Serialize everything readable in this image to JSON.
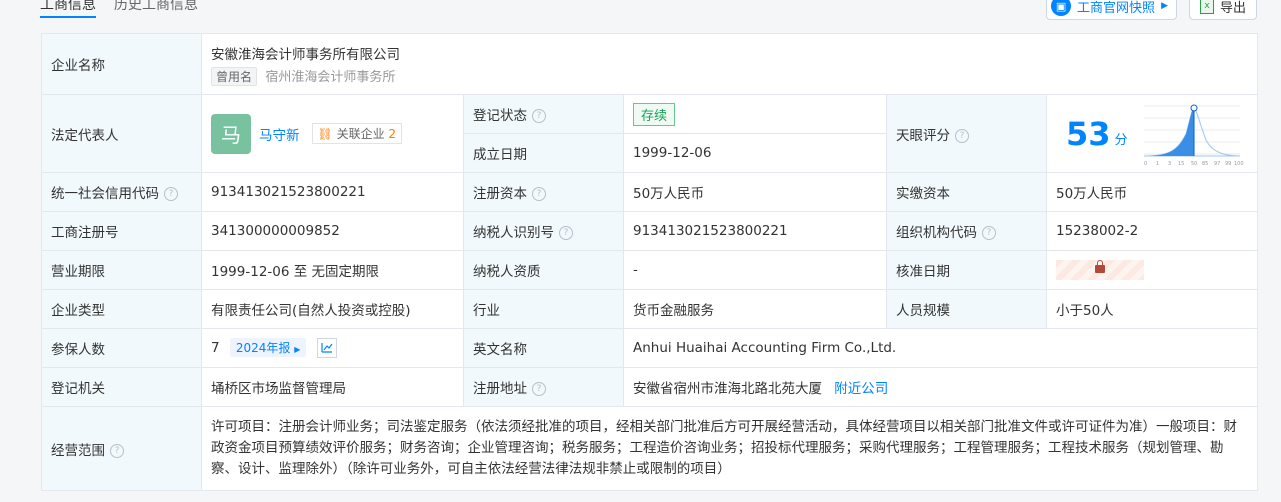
{
  "tabs": [
    {
      "label": "工商信息"
    },
    {
      "label": "历史工商信息"
    }
  ],
  "toolbar": {
    "snapshot_label": "工商官网快照",
    "export_label": "导出"
  },
  "company_name": {
    "label": "企业名称",
    "value": "安徽淮海会计师事务所有限公司",
    "former_tag": "曾用名",
    "former_value": "宿州淮海会计师事务所"
  },
  "legal_rep": {
    "label": "法定代表人",
    "avatar_char": "马",
    "name": "马守新",
    "related_label": "关联企业",
    "related_count": "2"
  },
  "reg_status": {
    "label": "登记状态",
    "value": "存续"
  },
  "found_date": {
    "label": "成立日期",
    "value": "1999-12-06"
  },
  "tianyan": {
    "label": "天眼评分",
    "score": "53",
    "unit": "分",
    "scale": [
      "0",
      "1",
      "3",
      "15",
      "50",
      "85",
      "97",
      "99",
      "100"
    ]
  },
  "credit_code": {
    "label": "统一社会信用代码",
    "value": "913413021523800221"
  },
  "reg_capital": {
    "label": "注册资本",
    "value": "50万人民币"
  },
  "paid_capital": {
    "label": "实缴资本",
    "value": "50万人民币"
  },
  "biz_reg_no": {
    "label": "工商注册号",
    "value": "341300000009852"
  },
  "taxpayer_id": {
    "label": "纳税人识别号",
    "value": "913413021523800221"
  },
  "org_code": {
    "label": "组织机构代码",
    "value": "15238002-2"
  },
  "biz_term": {
    "label": "营业期限",
    "value": "1999-12-06 至 无固定期限"
  },
  "taxpayer_qual": {
    "label": "纳税人资质",
    "value": "-"
  },
  "approve_date": {
    "label": "核准日期"
  },
  "company_type": {
    "label": "企业类型",
    "value": "有限责任公司(自然人投资或控股)"
  },
  "industry": {
    "label": "行业",
    "value": "货币金融服务"
  },
  "staff_size": {
    "label": "人员规模",
    "value": "小于50人"
  },
  "insured": {
    "label": "参保人数",
    "value": "7",
    "year": "2024年报"
  },
  "english_name": {
    "label": "英文名称",
    "value": "Anhui Huaihai Accounting Firm Co.,Ltd."
  },
  "reg_authority": {
    "label": "登记机关",
    "value": "埇桥区市场监督管理局"
  },
  "reg_address": {
    "label": "注册地址",
    "value": "安徽省宿州市淮海北路北苑大厦",
    "nearby": "附近公司"
  },
  "scope": {
    "label": "经营范围",
    "value": "许可项目：注册会计师业务；司法鉴定服务（依法须经批准的项目，经相关部门批准后方可开展经营活动，具体经营项目以相关部门批准文件或许可证件为准）一般项目：财政资金项目预算绩效评价服务；财务咨询；企业管理咨询；税务服务；工程造价咨询业务；招投标代理服务；采购代理服务；工程管理服务；工程技术服务（规划管理、勘察、设计、监理除外）（除许可业务外，可自主依法经营法律法规非禁止或限制的项目）"
  },
  "colors": {
    "accent": "#0084ff",
    "label_bg": "#f2f9fc",
    "ok": "#19a05a"
  }
}
